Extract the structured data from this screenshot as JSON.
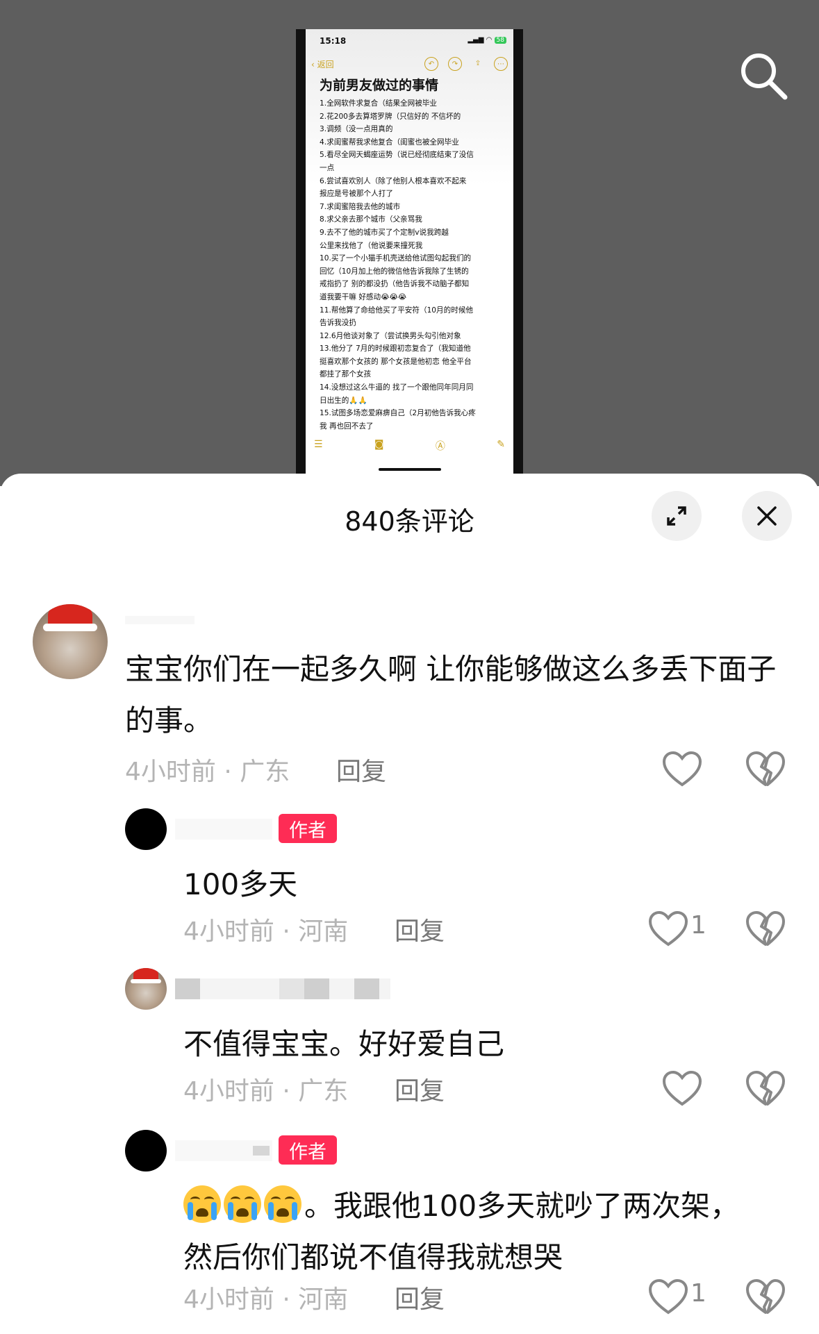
{
  "phone": {
    "time": "15:18",
    "battery": "58",
    "back_label": "返回",
    "note_title": "为前男友做过的事情",
    "lines": [
      "1.全网软件求复合（结果全网被毕业",
      "2.花200多去算塔罗牌（只信好的 不信坏的",
      "3.调频（没一点用真的",
      "4.求闺蜜帮我求他复合（闺蜜也被全网毕业",
      "5.看尽全网天蝎座运势（说已经彻底结束了没信",
      "一点",
      "6.尝试喜欢别人（除了他别人根本喜欢不起来",
      "报应是号被那个人打了",
      "7.求闺蜜陪我去他的城市",
      "8.求父亲去那个城市（父亲骂我",
      "9.去不了他的城市买了个定制v说我跨越",
      "公里来找他了（他说要来撞死我",
      "10.买了一个小猫手机壳送给他试图勾起我们的",
      "回忆（10月加上他的微信他告诉我除了生锈的",
      "戒指扔了 别的都没扔（他告诉我不动脑子都知",
      "道我要干嘛 好感动😭😭😭",
      "11.帮他算了命给他买了平安符（10月的时候他",
      "告诉我没扔",
      "12.6月他谈对象了（尝试换男头勾引他对象",
      "13.他分了 7月的时候跟初恋复合了（我知道他",
      "挺喜欢那个女孩的 那个女孩是他初恋 他全平台",
      "都挂了那个女孩",
      "14.没想过这么牛逼的 找了一个跟他同年同月同",
      "日出生的🙏🙏",
      "15.试图多场恋爱麻痹自己（2月初他告诉我心疼",
      "我 再也回不去了"
    ]
  },
  "sheet": {
    "title": "840条评论"
  },
  "comments": [
    {
      "text": "宝宝你们在一起多久啊 让你能够做这么多丢下面子的事。",
      "meta": "4小时前 · 广东",
      "reply": "回复",
      "likes": ""
    },
    {
      "badge": "作者",
      "text": "100多天",
      "meta": "4小时前 · 河南",
      "reply": "回复",
      "likes": "1"
    },
    {
      "text": "不值得宝宝。好好爱自己",
      "meta": "4小时前 · 广东",
      "reply": "回复",
      "likes": ""
    },
    {
      "badge": "作者",
      "text_after_emoji": "。我跟他100多天就吵了两次架，",
      "text_line2": "然后你们都说不值得我就想哭",
      "meta": "4小时前 · 河南",
      "reply": "回复",
      "likes": "1"
    }
  ],
  "colors": {
    "author_badge": "#fe2c55",
    "stage_bg": "#5e5e5e",
    "notes_accent": "#c9a21f"
  },
  "icons": [
    "search-icon",
    "expand-icon",
    "close-icon",
    "heart-icon",
    "broken-heart-icon",
    "crying-emoji-icon"
  ]
}
